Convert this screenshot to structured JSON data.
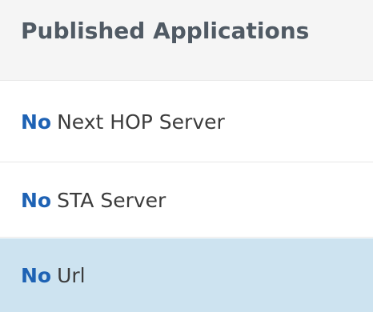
{
  "header": {
    "title": "Published Applications"
  },
  "rows": [
    {
      "status": "No",
      "label": "Next HOP Server",
      "selected": false
    },
    {
      "status": "No",
      "label": "STA Server",
      "selected": false
    },
    {
      "status": "No",
      "label": "Url",
      "selected": true
    }
  ],
  "colors": {
    "status_text": "#1e62b4",
    "selected_row_bg": "#cde3f0",
    "header_bg": "#f5f5f5"
  }
}
